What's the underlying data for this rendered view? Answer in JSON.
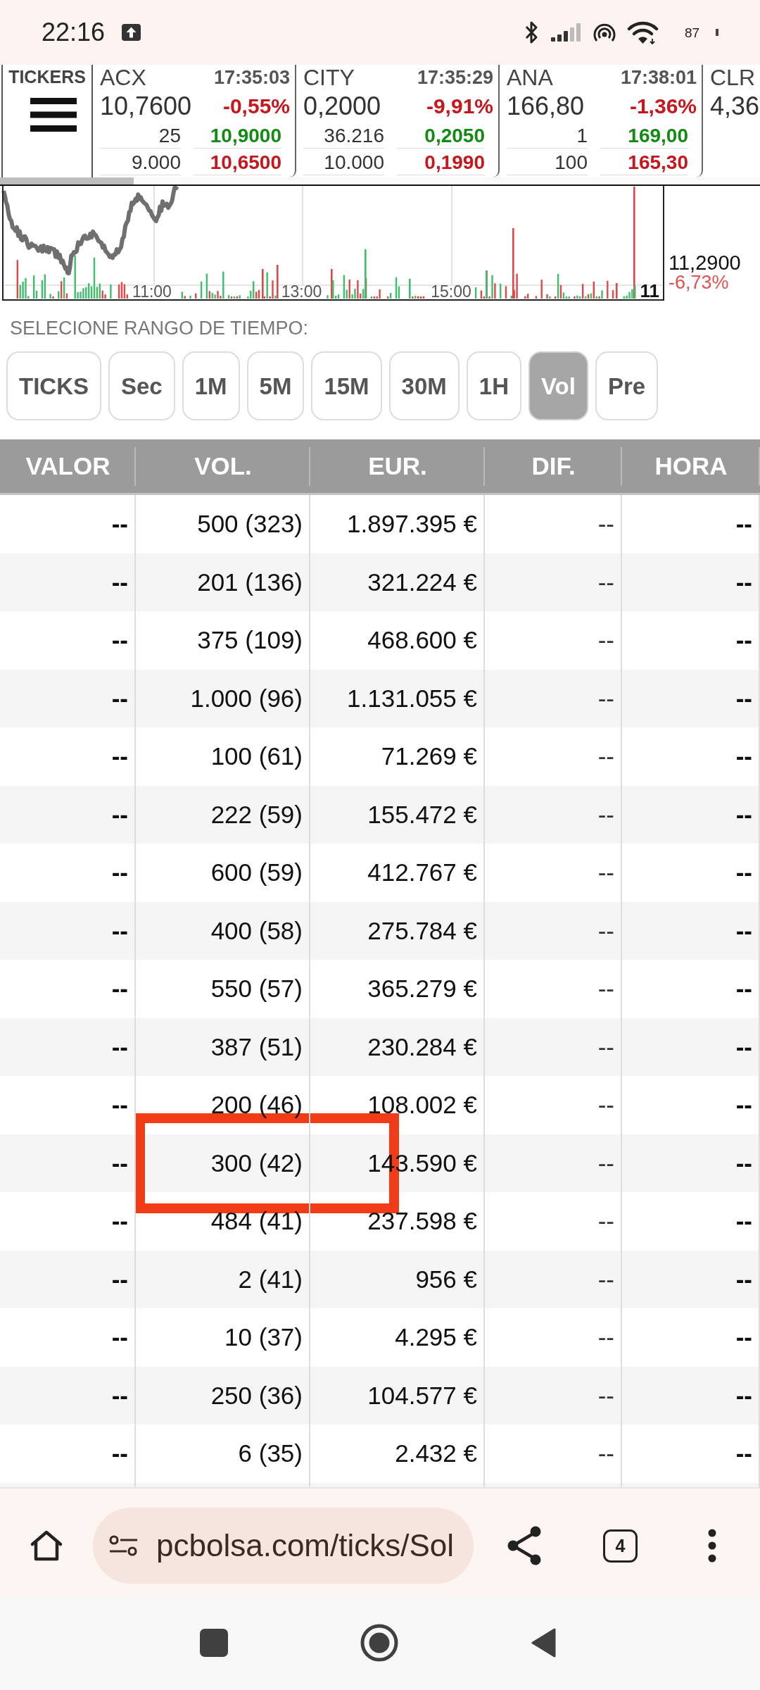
{
  "status_bar": {
    "time": "22:16",
    "battery": "87"
  },
  "tickers": {
    "label": "TICKERS",
    "items": [
      {
        "symbol": "ACX",
        "time": "17:35:03",
        "price": "10,7600",
        "change": "-0,55%",
        "falling": true,
        "levels": [
          {
            "quantity": "25",
            "price": "10,9000",
            "color": "#138a13"
          },
          {
            "quantity": "9.000",
            "price": "10,6500",
            "color": "#c8161d"
          }
        ]
      },
      {
        "symbol": "CITY",
        "time": "17:35:29",
        "price": "0,2000",
        "change": "-9,91%",
        "falling": true,
        "levels": [
          {
            "quantity": "36.216",
            "price": "0,2050",
            "color": "#138a13"
          },
          {
            "quantity": "10.000",
            "price": "0,1990",
            "color": "#c8161d"
          }
        ]
      },
      {
        "symbol": "ANA",
        "time": "17:38:01",
        "price": "166,80",
        "change": "-1,36%",
        "falling": true,
        "levels": [
          {
            "quantity": "1",
            "price": "169,00",
            "color": "#138a13"
          },
          {
            "quantity": "100",
            "price": "165,30",
            "color": "#c8161d"
          }
        ]
      },
      {
        "symbol": "CLR",
        "price": "4,36"
      }
    ]
  },
  "chart": {
    "time_labels": [
      "11:00",
      "13:00",
      "15:00"
    ],
    "end_label": "11",
    "price_label": "11,2900",
    "change_label": "-6,73%",
    "change_falling": true
  },
  "range_selector": {
    "label": "SELECIONE RANGO DE TIEMPO:",
    "options": [
      {
        "label": "TICKS",
        "selected": false
      },
      {
        "label": "Sec",
        "selected": false
      },
      {
        "label": "1M",
        "selected": false
      },
      {
        "label": "5M",
        "selected": false
      },
      {
        "label": "15M",
        "selected": false
      },
      {
        "label": "30M",
        "selected": false
      },
      {
        "label": "1H",
        "selected": false
      },
      {
        "label": "Vol",
        "selected": true
      },
      {
        "label": "Pre",
        "selected": false
      }
    ]
  },
  "table": {
    "columns": [
      "VALOR",
      "VOL.",
      "EUR.",
      "DIF.",
      "HORA"
    ],
    "rows": [
      {
        "cells": [
          "--",
          "500 (323)",
          "1.897.395 €",
          "--",
          "--"
        ],
        "marked": false
      },
      {
        "cells": [
          "--",
          "201 (136)",
          "321.224 €",
          "--",
          "--"
        ],
        "marked": false
      },
      {
        "cells": [
          "--",
          "375 (109)",
          "468.600 €",
          "--",
          "--"
        ],
        "marked": false
      },
      {
        "cells": [
          "--",
          "1.000 (96)",
          "1.131.055 €",
          "--",
          "--"
        ],
        "marked": false
      },
      {
        "cells": [
          "--",
          "100 (61)",
          "71.269 €",
          "--",
          "--"
        ],
        "marked": false
      },
      {
        "cells": [
          "--",
          "222 (59)",
          "155.472 €",
          "--",
          "--"
        ],
        "marked": false
      },
      {
        "cells": [
          "--",
          "600 (59)",
          "412.767 €",
          "--",
          "--"
        ],
        "marked": false
      },
      {
        "cells": [
          "--",
          "400 (58)",
          "275.784 €",
          "--",
          "--"
        ],
        "marked": false
      },
      {
        "cells": [
          "--",
          "550 (57)",
          "365.279 €",
          "--",
          "--"
        ],
        "marked": false
      },
      {
        "cells": [
          "--",
          "387 (51)",
          "230.284 €",
          "--",
          "--"
        ],
        "marked": false
      },
      {
        "cells": [
          "--",
          "200 (46)",
          "108.002 €",
          "--",
          "--"
        ],
        "marked": false
      },
      {
        "cells": [
          "--",
          "300 (42)",
          "143.590 €",
          "--",
          "--"
        ],
        "marked": true
      },
      {
        "cells": [
          "--",
          "484 (41)",
          "237.598 €",
          "--",
          "--"
        ],
        "marked": false
      },
      {
        "cells": [
          "--",
          "2 (41)",
          "956 €",
          "--",
          "--"
        ],
        "marked": false
      },
      {
        "cells": [
          "--",
          "10 (37)",
          "4.295 €",
          "--",
          "--"
        ],
        "marked": false
      },
      {
        "cells": [
          "--",
          "250 (36)",
          "104.577 €",
          "--",
          "--"
        ],
        "marked": false
      },
      {
        "cells": [
          "--",
          "6 (35)",
          "2.432 €",
          "--",
          "--"
        ],
        "marked": false
      }
    ]
  },
  "browser_bar": {
    "url": "pcbolsa.com/ticks/Sol",
    "tab_count": "4"
  }
}
